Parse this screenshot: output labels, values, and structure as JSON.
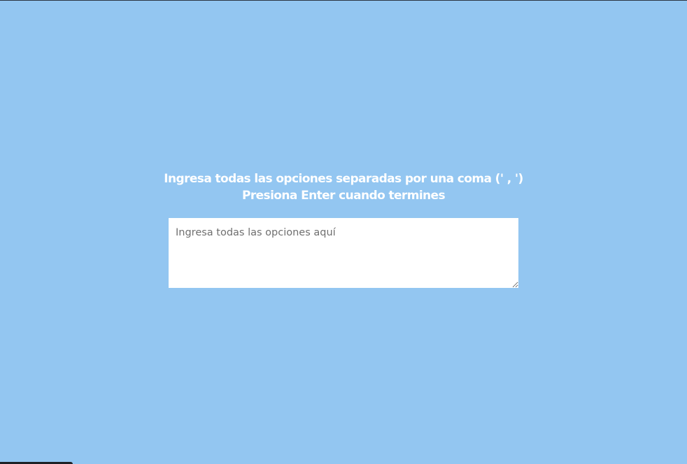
{
  "instructions": {
    "line1": "Ingresa todas las opciones separadas por una coma (' , ')",
    "line2": "Presiona Enter cuando termines"
  },
  "options_input": {
    "value": "",
    "placeholder": "Ingresa todas las opciones aquí"
  },
  "colors": {
    "background": "#93c6f1",
    "text": "#ffffff",
    "input_background": "#ffffff",
    "placeholder": "#6f6f6f"
  }
}
